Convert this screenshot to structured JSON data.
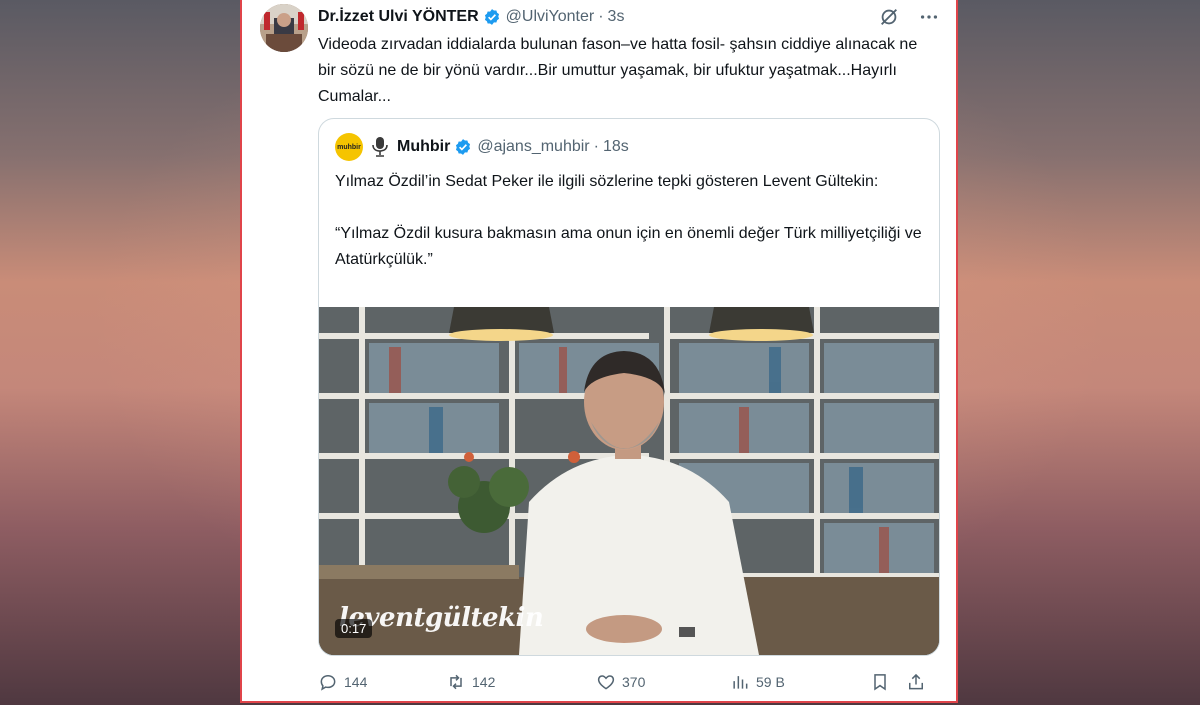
{
  "tweet": {
    "author_name": "Dr.İzzet Ulvi YÖNTER",
    "handle": "@UlviYonter",
    "separator": "·",
    "time": "3s",
    "text": "Videoda zırvadan iddialarda bulunan fason–ve hatta fosil- şahsın ciddiye alınacak ne bir sözü ne de bir yönü vardır...Bir umuttur yaşamak, bir ufuktur yaşatmak...Hayırlı Cumalar..."
  },
  "quote": {
    "logo_text": "muhbir",
    "author_name": "Muhbir",
    "handle": "@ajans_muhbir",
    "separator": "·",
    "time": "18s",
    "text_line1": "Yılmaz Özdil’in Sedat Peker ile ilgili sözlerine tepki gösteren Levent Gültekin:",
    "text_line2": "“Yılmaz Özdil kusura bakmasın ama onun için en önemli değer Türk milliyetçiliği ve Atatürkçülük.”",
    "video": {
      "duration": "0:17",
      "watermark": "leventgültekin"
    }
  },
  "actions": {
    "replies": "144",
    "retweets": "142",
    "likes": "370",
    "views": "59 B"
  },
  "colors": {
    "text": "#0f1419",
    "muted": "#536471",
    "verified": "#1d9bf0",
    "border": "#cfd9de",
    "frame": "#e0444a"
  }
}
